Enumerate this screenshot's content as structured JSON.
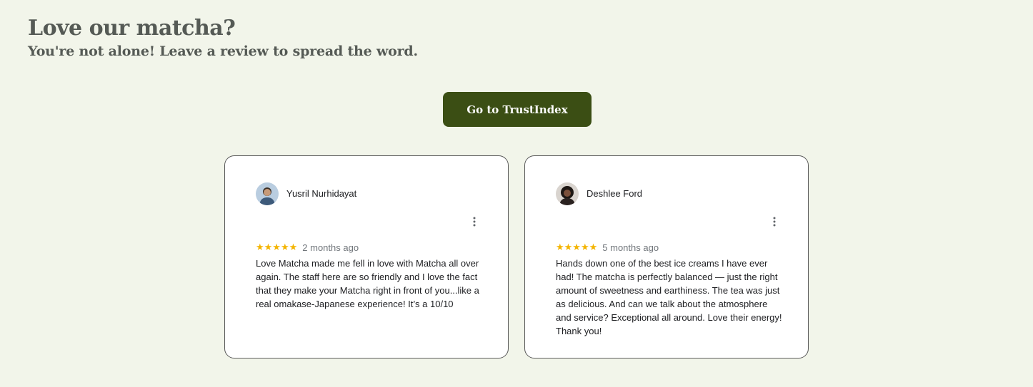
{
  "header": {
    "title": "Love our matcha?",
    "subtitle": "You're not alone! Leave a review to spread the word."
  },
  "cta": {
    "label": "Go to TrustIndex"
  },
  "colors": {
    "background": "#f2f5ea",
    "cta_background": "#3b4e14",
    "heading": "#555a55",
    "star": "#f4b400"
  },
  "reviews": [
    {
      "author": "Yusril Nurhidayat",
      "rating": 5,
      "stars": "★★★★★",
      "time": "2 months ago",
      "text": "Love Matcha made me fell in love with Matcha all over again. The staff here are so friendly and I love the fact that they make your Matcha right in front of you...like a real omakase-Japanese experience! It’s a 10/10"
    },
    {
      "author": "Deshlee Ford",
      "rating": 5,
      "stars": "★★★★★",
      "time": "5 months ago",
      "text": "Hands down one of the best ice creams I have ever had! The matcha is perfectly balanced — just the right amount of sweetness and earthiness. The tea was just as delicious. And can we talk about the atmosphere and service? Exceptional all around. Love their energy! Thank you!"
    }
  ]
}
